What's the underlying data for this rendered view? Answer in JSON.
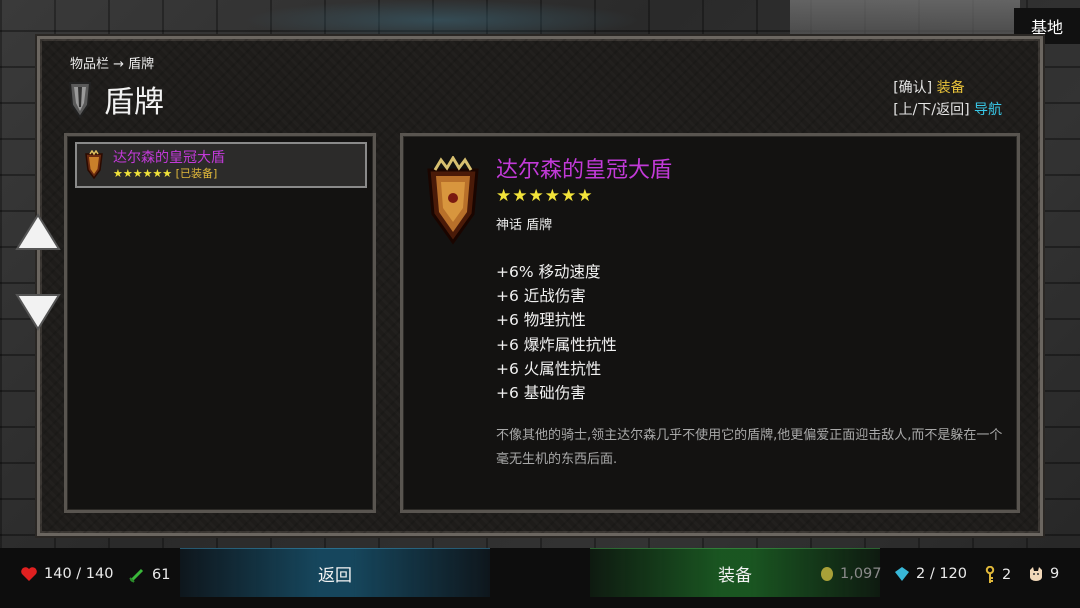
{
  "header": {
    "location": "基地"
  },
  "panel": {
    "breadcrumb": "物品栏 → 盾牌",
    "title": "盾牌",
    "hints": {
      "confirm_key": "[确认]",
      "confirm_action": "装备",
      "nav_keys": "[上/下/返回]",
      "nav_action": "导航"
    }
  },
  "list": {
    "items": [
      {
        "name": "达尔森的皇冠大盾",
        "stars": "★★★★★★",
        "status": "[已装备]",
        "icon": "crown-shield-icon"
      }
    ]
  },
  "detail": {
    "name": "达尔森的皇冠大盾",
    "stars": "★★★★★★",
    "type": "神话 盾牌",
    "stats": [
      "+6% 移动速度",
      "+6 近战伤害",
      "+6 物理抗性",
      "+6 爆炸属性抗性",
      "+6 火属性抗性",
      "+6 基础伤害"
    ],
    "description": "不像其他的骑士,领主达尔森几乎不使用它的盾牌,他更偏爱正面迎击敌人,而不是躲在一个毫无生机的东西后面."
  },
  "footer": {
    "back_label": "返回",
    "equip_label": "装备",
    "health": "140 / 140",
    "stamina": "61",
    "gold": "1,097",
    "gems": "2 / 120",
    "keys": "2",
    "pets": "9"
  },
  "colors": {
    "legendary_name": "#c23ad8",
    "stars": "#f2e33a",
    "confirm_action": "#e8c23a",
    "nav_action": "#38c8e8",
    "back_button": "#19587a",
    "equip_button": "#1e6e28"
  }
}
